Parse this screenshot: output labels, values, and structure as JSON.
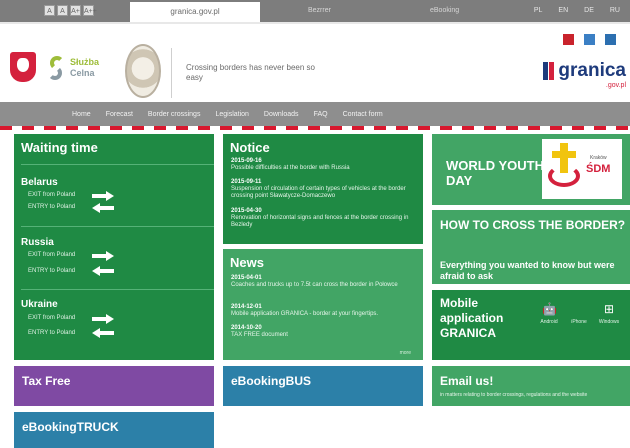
{
  "topbar": {
    "font_controls": [
      "A",
      "A",
      "A+",
      "A++"
    ],
    "tabs": [
      "granica.gov.pl",
      "Bezrrer",
      "eBooking"
    ],
    "languages": [
      "PL",
      "EN",
      "DE",
      "RU"
    ]
  },
  "header": {
    "sluzba_line1": "Służba",
    "sluzba_line2": "Celna",
    "tagline": "Crossing borders has never been so easy",
    "brand_word": "granica",
    "brand_sub": ".gov.pl"
  },
  "nav": {
    "items": [
      "Home",
      "Forecast",
      "Border crossings",
      "Legislation",
      "Downloads",
      "FAQ",
      "Contact form"
    ]
  },
  "waiting_time": {
    "title": "Waiting time",
    "countries": [
      {
        "name": "Belarus",
        "exit": "EXIT from Poland",
        "entry": "ENTRY to Poland"
      },
      {
        "name": "Russia",
        "exit": "EXIT from Poland",
        "entry": "ENTRY to Poland"
      },
      {
        "name": "Ukraine",
        "exit": "EXIT from Poland",
        "entry": "ENTRY to Poland"
      }
    ]
  },
  "notice": {
    "title": "Notice",
    "items": [
      {
        "date": "2015-09-16",
        "text": "Possible difficulties at the border with Russia"
      },
      {
        "date": "2015-09-11",
        "text": "Suspension of circulation of certain types of vehicles at the border crossing point Sławatycze-Domaczewo"
      },
      {
        "date": "2015-04-30",
        "text": "Renovation of horizontal signs and fences at the border crossing in Bezledy"
      }
    ]
  },
  "news": {
    "title": "News",
    "items": [
      {
        "date": "2015-04-01",
        "text": "Coaches and trucks up to 7.5t can cross the border in Połowce"
      },
      {
        "date": "2014-12-01",
        "text": "Mobile application GRANICA - border at your fingertips."
      },
      {
        "date": "2014-10-20",
        "text": "TAX FREE document"
      }
    ],
    "more": "more"
  },
  "wyd": {
    "title": "WORLD YOUTH DAY",
    "logo_city": "Kraków",
    "logo_text": "ŚDM"
  },
  "how_to_cross": {
    "title": "HOW TO CROSS THE BORDER?",
    "subtitle": "Everything you wanted to know but were afraid to ask"
  },
  "mobile": {
    "title": "Mobile application GRANICA",
    "platforms": [
      {
        "icon": "android-icon",
        "label": "Android"
      },
      {
        "icon": "apple-icon",
        "label": "iPhone"
      },
      {
        "icon": "windows-icon",
        "label": "Windows"
      }
    ]
  },
  "tiles": {
    "tax_free": "Tax Free",
    "ebooking_bus": "eBookingBUS",
    "ebooking_truck": "eBookingTRUCK"
  },
  "email": {
    "title": "Email us!",
    "subtitle": "in matters relating to border crossings, regulations and the website"
  },
  "colors": {
    "green": "#1f8a44",
    "light_green": "#42a565",
    "purple": "#7f4aa3",
    "blue": "#2c80a8",
    "nav_gray": "#8e8e8e",
    "brand_red": "#d8182e"
  }
}
